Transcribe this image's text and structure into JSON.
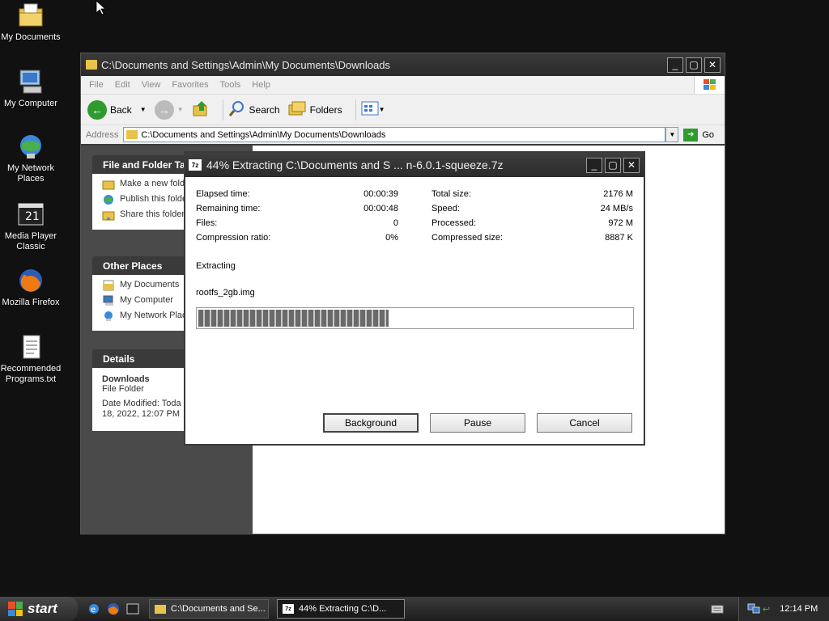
{
  "desktop": {
    "icons": [
      {
        "label": "My Documents"
      },
      {
        "label": "My Computer"
      },
      {
        "label": "My Network Places"
      },
      {
        "label": "Media Player Classic"
      },
      {
        "label": "Mozilla Firefox"
      },
      {
        "label": "Recommended Programs.txt"
      }
    ]
  },
  "explorer": {
    "title": "C:\\Documents and Settings\\Admin\\My Documents\\Downloads",
    "menu": [
      "File",
      "Edit",
      "View",
      "Favorites",
      "Tools",
      "Help"
    ],
    "toolbar": {
      "back": "Back",
      "search": "Search",
      "folders": "Folders"
    },
    "address": {
      "label": "Address",
      "value": "C:\\Documents and Settings\\Admin\\My Documents\\Downloads",
      "go": "Go"
    },
    "tasks_panel": {
      "title": "File and Folder Ta",
      "items": [
        "Make a new fold",
        "Publish this folde Web",
        "Share this folder"
      ]
    },
    "places_panel": {
      "title": "Other Places",
      "items": [
        "My Documents",
        "My Computer",
        "My Network Plac"
      ]
    },
    "details_panel": {
      "title": "Details",
      "name": "Downloads",
      "type": "File Folder",
      "modified": "Date Modified: Toda 18, 2022, 12:07 PM"
    }
  },
  "dialog": {
    "title": "44% Extracting C:\\Documents and S ... n-6.0.1-squeeze.7z",
    "progress_percent": 44,
    "stats_left": [
      {
        "key": "Elapsed time:",
        "value": "00:00:39"
      },
      {
        "key": "Remaining time:",
        "value": "00:00:48"
      },
      {
        "key": "Files:",
        "value": "0"
      },
      {
        "key": "Compression ratio:",
        "value": "0%"
      }
    ],
    "stats_right": [
      {
        "key": "Total size:",
        "value": "2176 M"
      },
      {
        "key": "Speed:",
        "value": "24 MB/s"
      },
      {
        "key": "Processed:",
        "value": "972 M"
      },
      {
        "key": "Compressed size:",
        "value": "8887 K"
      }
    ],
    "status": "Extracting",
    "current_file": "rootfs_2gb.img",
    "buttons": {
      "background": "Background",
      "pause": "Pause",
      "cancel": "Cancel"
    }
  },
  "taskbar": {
    "start": "start",
    "tasks": [
      "C:\\Documents and Se...",
      "44% Extracting C:\\D..."
    ],
    "clock": "12:14 PM"
  },
  "colors": {
    "folder": "#e8c24a",
    "title_bar": "#2b2b2b",
    "go_green": "#2f9b2f"
  }
}
